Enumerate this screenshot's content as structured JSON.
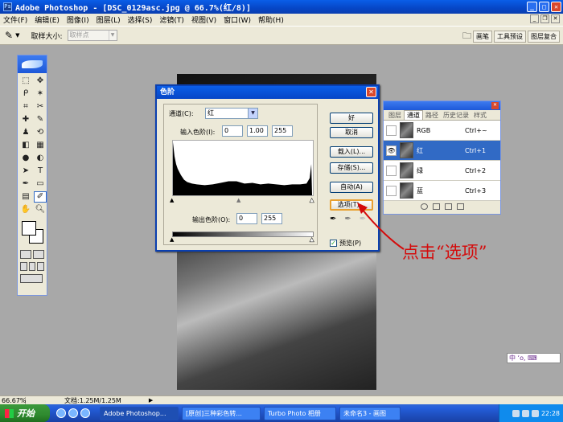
{
  "window": {
    "title": "Adobe Photoshop - [DSC_0129asc.jpg @ 66.7%(红/8)]"
  },
  "menu": [
    "文件(F)",
    "编辑(E)",
    "图像(I)",
    "图层(L)",
    "选择(S)",
    "滤镜(T)",
    "视图(V)",
    "窗口(W)",
    "帮助(H)"
  ],
  "options": {
    "sample_label": "取样大小:",
    "sample_value": "取样点"
  },
  "palette_well": [
    "画笔",
    "工具预设",
    "图层复合"
  ],
  "levels": {
    "title": "色阶",
    "channel_label": "通道(C):",
    "channel_value": "红",
    "input_label": "输入色阶(I):",
    "input_values": [
      "0",
      "1.00",
      "255"
    ],
    "output_label": "输出色阶(O):",
    "output_values": [
      "0",
      "255"
    ],
    "buttons": {
      "ok": "好",
      "cancel": "取消",
      "load": "载入(L)...",
      "save": "存储(S)...",
      "auto": "自动(A)",
      "options": "选项(T)..."
    },
    "preview_label": "预览(P)",
    "preview_checked": true
  },
  "channels_panel": {
    "tabs": [
      "图层",
      "通道",
      "路径",
      "历史记录",
      "样式"
    ],
    "rows": [
      {
        "name": "RGB",
        "shortcut": "Ctrl+~"
      },
      {
        "name": "红",
        "shortcut": "Ctrl+1"
      },
      {
        "name": "绿",
        "shortcut": "Ctrl+2"
      },
      {
        "name": "蓝",
        "shortcut": "Ctrl+3"
      }
    ]
  },
  "annotation": "点击“选项”",
  "status": {
    "zoom": "66.67%",
    "doc": "文档:1.25M/1.25M"
  },
  "taskbar": {
    "start": "开始",
    "tasks": [
      "Adobe Photoshop...",
      "[原创]三种彩色转...",
      "Turbo Photo 相册",
      "未命名3 - 画图"
    ],
    "clock": "22:28"
  },
  "ime": "中 ‘o, ⌨"
}
